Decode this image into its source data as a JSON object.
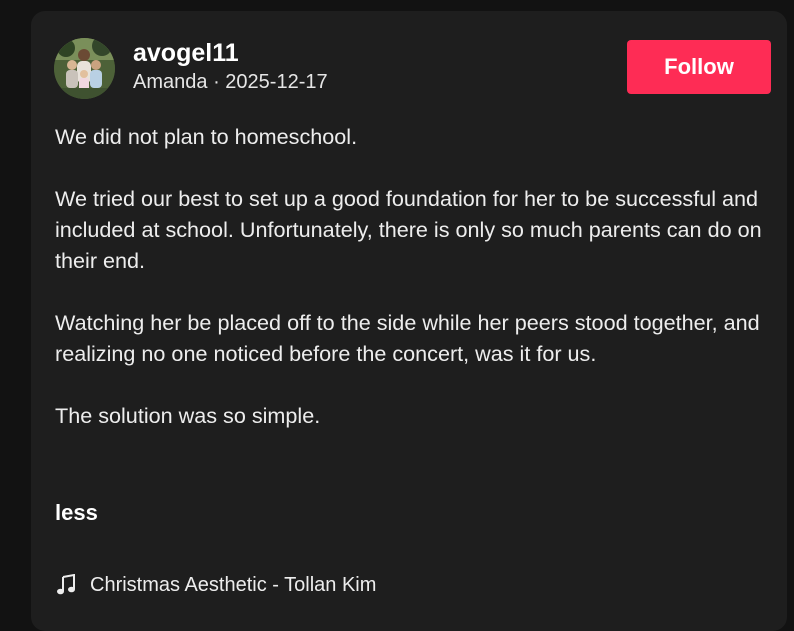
{
  "post": {
    "username": "avogel11",
    "display_name": "Amanda",
    "separator": "·",
    "date": "2025-12-17",
    "follow_label": "Follow",
    "avatar_icon": "family-photo-avatar",
    "caption": [
      "We did not plan to homeschool.",
      "We tried our best to set up a good foundation for her to be successful and included at school. Unfortunately, there is only so much parents can do on their end.",
      "Watching her be placed off to the side while her peers stood together, and realizing no one noticed before the concert, was it for us.",
      "The solution was so simple."
    ],
    "less_label": "less",
    "music_icon": "music-note-icon",
    "music_label": "Christmas Aesthetic - Tollan Kim"
  },
  "colors": {
    "page_bg": "#121212",
    "card_bg": "#1e1e1e",
    "follow_bg": "#fe2c55",
    "text": "#ededed"
  }
}
